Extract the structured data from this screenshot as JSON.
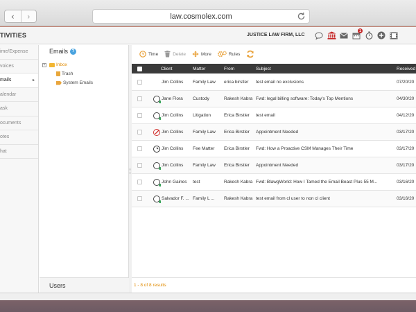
{
  "browser": {
    "url": "law.cosmolex.com",
    "back_glyph": "‹",
    "forward_glyph": "›"
  },
  "header": {
    "title": "TIVITIES",
    "firm": "JUSTICE LAW FIRM, LLC",
    "icons": [
      "chat-bubble-icon",
      "bank-icon",
      "envelope-icon",
      "calendar-icon",
      "stopwatch-icon",
      "plus-circle-icon",
      "film-icon"
    ],
    "calendar_badge": "1"
  },
  "left_nav": {
    "items": [
      {
        "label": "ime/Expense",
        "active": false
      },
      {
        "label": "voices",
        "active": false
      },
      {
        "label": "mails",
        "active": true
      },
      {
        "label": "alendar",
        "active": false
      },
      {
        "label": "ask",
        "active": false
      },
      {
        "label": "ocuments",
        "active": false
      },
      {
        "label": "otes",
        "active": false
      },
      {
        "label": "hat",
        "active": false
      }
    ],
    "active_arrow": "▸"
  },
  "folders": {
    "title": "Emails",
    "help": "?",
    "toggle": "+",
    "inbox": "Inbox",
    "trash": "Trash",
    "system": "System Emails",
    "users": "Users"
  },
  "toolbar": {
    "time": "Time",
    "delete": "Delete",
    "more": "More",
    "rules": "Rules"
  },
  "grid": {
    "columns": {
      "client": "Client",
      "matter": "Matter",
      "from": "From",
      "subject": "Subject",
      "received": "Received"
    },
    "rows": [
      {
        "icon": "none",
        "client": "Jim Collins",
        "matter": "Family Law",
        "from": "erica birstler",
        "subject": "test email no exclusions",
        "received": "07/20/20"
      },
      {
        "icon": "green",
        "client": "Jane Flora",
        "matter": "Custody",
        "from": "Rakesh Kabra",
        "subject": "Fwd: legal billing software: Today's Top Mentions",
        "received": "04/30/20"
      },
      {
        "icon": "green",
        "client": "Jim Collins",
        "matter": "Litigation",
        "from": "Erica Birstler",
        "subject": "test email",
        "received": "04/12/20"
      },
      {
        "icon": "red",
        "client": "Jim Collins",
        "matter": "Family Law",
        "from": "Erica Birstler",
        "subject": "Appointment Needed",
        "received": "03/17/20"
      },
      {
        "icon": "clock",
        "client": "Jim Collins",
        "matter": "Fee Matter",
        "from": "Erica Birstler",
        "subject": "Fwd: How a Proactive CSM Manages Their Time",
        "received": "03/17/20"
      },
      {
        "icon": "green",
        "client": "Jim Collins",
        "matter": "Family Law",
        "from": "Erica Birstler",
        "subject": "Appointment Needed",
        "received": "03/17/20"
      },
      {
        "icon": "green",
        "client": "John Gaines",
        "matter": "test",
        "from": "Rakesh Kabra",
        "subject": "Fwd: BlawgWorld: How I Tamed the Email Beast Plus 55 M...",
        "received": "03/16/20"
      },
      {
        "icon": "green",
        "client": "Salvador F. ...",
        "matter": "Family L ...",
        "from": "Rakesh Kabra",
        "subject": "test email from cl user to non cl client",
        "received": "03/16/20"
      }
    ]
  },
  "footer": {
    "results": "1 - 8 of 8 results"
  },
  "colors": {
    "accent_orange": "#e08a00",
    "header_dark": "#3a3a3a",
    "badge_red": "#c62828",
    "bank_red": "#c62828"
  }
}
